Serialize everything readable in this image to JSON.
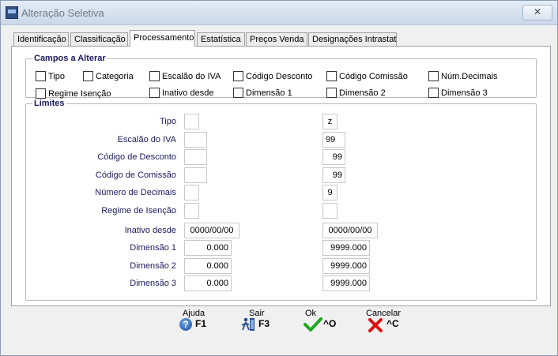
{
  "window": {
    "title": "Alteração Seletiva",
    "close_icon": "✕"
  },
  "tabs": [
    {
      "label": "Identificação"
    },
    {
      "label": "Classificação"
    },
    {
      "label": "Processamento"
    },
    {
      "label": "Estatística"
    },
    {
      "label": "Preços Venda"
    },
    {
      "label": "Designações Intrastat"
    }
  ],
  "campos": {
    "legend": "Campos a Alterar",
    "items": [
      {
        "label": "Tipo"
      },
      {
        "label": "Categoria"
      },
      {
        "label": "Escalão do IVA"
      },
      {
        "label": "Código Desconto"
      },
      {
        "label": "Código Comissão"
      },
      {
        "label": "Núm.Decimais"
      },
      {
        "label": "Regime Isenção"
      },
      {
        "label": "Inativo desde"
      },
      {
        "label": "Dimensão 1"
      },
      {
        "label": "Dimensão 2"
      },
      {
        "label": "Dimensão 3"
      }
    ]
  },
  "limites": {
    "legend": "Limites",
    "rows": [
      {
        "label": "Tipo",
        "from": "",
        "to": "z"
      },
      {
        "label": "Escalão do IVA",
        "from": "",
        "to": "99"
      },
      {
        "label": "Código de Desconto",
        "from": "",
        "to": "99"
      },
      {
        "label": "Código de Comissão",
        "from": "",
        "to": "99"
      },
      {
        "label": "Número de Decimais",
        "from": "",
        "to": "9"
      },
      {
        "label": "Regime de Isenção",
        "from": "",
        "to": ""
      },
      {
        "label": "Inativo desde",
        "from": "0000/00/00",
        "to": "0000/00/00"
      },
      {
        "label": "Dimensão 1",
        "from": "0.000",
        "to": "9999.000"
      },
      {
        "label": "Dimensão 2",
        "from": "0.000",
        "to": "9999.000"
      },
      {
        "label": "Dimensão 3",
        "from": "0.000",
        "to": "9999.000"
      }
    ]
  },
  "actions": {
    "help": {
      "label": "Ajuda",
      "key": "F1",
      "icon": "help-icon",
      "glyph": "?"
    },
    "exit": {
      "label": "Sair",
      "key": "F3",
      "icon": "exit-icon"
    },
    "ok": {
      "label": "Ok",
      "key": "^O",
      "icon": "check-icon",
      "color": "#1fa81f"
    },
    "cancel": {
      "label": "Cancelar",
      "key": "^C",
      "icon": "x-icon",
      "color": "#e01010"
    }
  }
}
